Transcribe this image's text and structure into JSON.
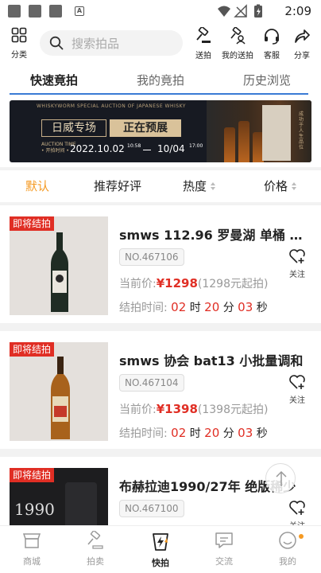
{
  "status_bar": {
    "time": "2:09"
  },
  "toolbar": {
    "category_label": "分类",
    "search_placeholder": "搜索拍品",
    "actions": [
      {
        "label": "送拍",
        "icon": "gavel-icon"
      },
      {
        "label": "我的送拍",
        "icon": "my-consign-icon"
      },
      {
        "label": "客服",
        "icon": "headset-icon"
      },
      {
        "label": "分享",
        "icon": "share-icon"
      }
    ]
  },
  "tabs": [
    {
      "label": "快速竟拍",
      "active": true
    },
    {
      "label": "我的竟拍",
      "active": false
    },
    {
      "label": "历史浏览",
      "active": false
    }
  ],
  "banner": {
    "top_text": "WHISKYWORM SPECIAL AUCTION OF JAPANESE WHISKY",
    "title": "日威专场",
    "status": "正在预展",
    "auction_time_label": "AUCTION TIME",
    "auction_time_sub": "• 开拍时间 •",
    "start_date": "2022.10.02",
    "start_time": "10:58",
    "end_date": "10/04",
    "end_time": "17:00",
    "side_text": "成功于人生品位"
  },
  "sort": [
    {
      "label": "默认",
      "active": true,
      "arrows": false
    },
    {
      "label": "推荐好评",
      "active": false,
      "arrows": false
    },
    {
      "label": "热度",
      "active": false,
      "arrows": true
    },
    {
      "label": "价格",
      "active": false,
      "arrows": true
    }
  ],
  "items": [
    {
      "tag": "即将结拍",
      "title": "smws 112.96 罗曼湖 单桶 1...",
      "lot": "NO.467106",
      "price_label": "当前价:",
      "price": "¥1298",
      "start_price": "(1298元起拍)",
      "time_label": "结拍时间:",
      "hours": "02",
      "hours_unit": "时",
      "minutes": "20",
      "minutes_unit": "分",
      "seconds": "03",
      "seconds_unit": "秒",
      "follow_label": "关注"
    },
    {
      "tag": "即将结拍",
      "title": "smws 协会 bat13 小批量调和",
      "lot": "NO.467104",
      "price_label": "当前价:",
      "price": "¥1398",
      "start_price": "(1398元起拍)",
      "time_label": "结拍时间:",
      "hours": "02",
      "hours_unit": "时",
      "minutes": "20",
      "minutes_unit": "分",
      "seconds": "03",
      "seconds_unit": "秒",
      "follow_label": "关注"
    },
    {
      "tag": "即将结拍",
      "title": "布赫拉迪1990/27年 绝版稀少",
      "lot": "NO.467100",
      "follow_label": "关注",
      "image_text": "1990"
    }
  ],
  "bottom_nav": [
    {
      "label": "商城",
      "icon": "store-icon",
      "active": false
    },
    {
      "label": "拍卖",
      "icon": "auction-icon",
      "active": false
    },
    {
      "label": "快拍",
      "icon": "quick-auction-icon",
      "active": true
    },
    {
      "label": "交流",
      "icon": "chat-icon",
      "active": false
    },
    {
      "label": "我的",
      "icon": "profile-icon",
      "active": false
    }
  ],
  "colors": {
    "accent_orange": "#f59a23",
    "price_red": "#e02e24",
    "tab_underline": "#3a7bd5"
  }
}
